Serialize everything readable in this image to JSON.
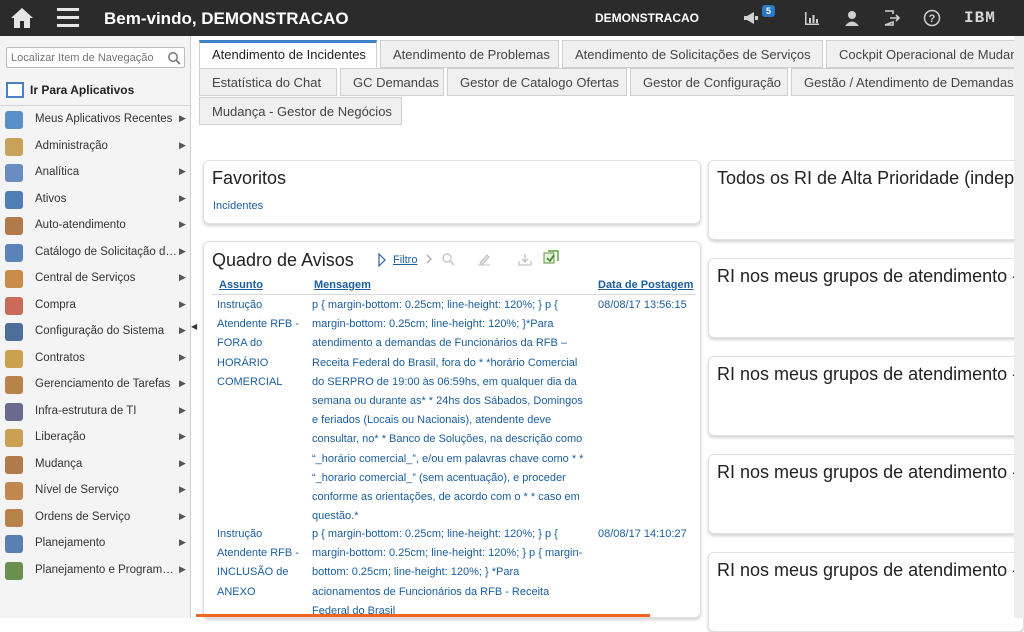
{
  "topbar": {
    "title": "Bem-vindo, DEMONSTRACAO",
    "user": "DEMONSTRACAO",
    "notification_count": "5",
    "brand": "IBM"
  },
  "sidebar": {
    "search_placeholder": "Localizar Item de Navegação",
    "goto_label": "Ir Para Aplicativos",
    "items": [
      {
        "label": "Meus Aplicativos Recentes",
        "icon": "recent-apps-icon",
        "color": "#5b8fc7"
      },
      {
        "label": "Administração",
        "icon": "administration-icon",
        "color": "#c9a25a"
      },
      {
        "label": "Analítica",
        "icon": "analytics-icon",
        "color": "#6a8cc0"
      },
      {
        "label": "Ativos",
        "icon": "assets-icon",
        "color": "#4f7fb5"
      },
      {
        "label": "Auto-atendimento",
        "icon": "self-service-icon",
        "color": "#b07a4a"
      },
      {
        "label": "Catálogo de Solicitação de Serviço",
        "icon": "service-catalog-icon",
        "color": "#5a84b8"
      },
      {
        "label": "Central de Serviços",
        "icon": "service-desk-icon",
        "color": "#c88b4a"
      },
      {
        "label": "Compra",
        "icon": "purchase-icon",
        "color": "#c96a5a"
      },
      {
        "label": "Configuração do Sistema",
        "icon": "system-config-icon",
        "color": "#4b6f99"
      },
      {
        "label": "Contratos",
        "icon": "contracts-icon",
        "color": "#c8a24e"
      },
      {
        "label": "Gerenciamento de Tarefas",
        "icon": "task-management-icon",
        "color": "#b8834a"
      },
      {
        "label": "Infra-estrutura de TI",
        "icon": "it-infrastructure-icon",
        "color": "#6a6a8c"
      },
      {
        "label": "Liberação",
        "icon": "release-icon",
        "color": "#caa052"
      },
      {
        "label": "Mudança",
        "icon": "change-icon",
        "color": "#b07a4a"
      },
      {
        "label": "Nível de Serviço",
        "icon": "service-level-icon",
        "color": "#c08850"
      },
      {
        "label": "Ordens de Serviço",
        "icon": "work-orders-icon",
        "color": "#b8834a"
      },
      {
        "label": "Planejamento",
        "icon": "planning-icon",
        "color": "#5a7fb0"
      },
      {
        "label": "Planejamento e Programação",
        "icon": "planning-scheduling-icon",
        "color": "#6b8f4f"
      }
    ]
  },
  "tabs": [
    {
      "label": "Atendimento de Incidentes",
      "active": true
    },
    {
      "label": "Atendimento de Problemas"
    },
    {
      "label": "Atendimento de Solicitações de Serviços"
    },
    {
      "label": "Cockpit Operacional de Mudança"
    },
    {
      "label": "Estatística do Chat"
    },
    {
      "label": "GC Demandas"
    },
    {
      "label": "Gestor de Catalogo Ofertas"
    },
    {
      "label": "Gestor de Configuração"
    },
    {
      "label": "Gestão / Atendimento de Demandas"
    },
    {
      "label": "Mudança - Gestor de Negócios"
    }
  ],
  "favorites": {
    "title": "Favoritos",
    "link": "Incidentes"
  },
  "bulletin": {
    "title": "Quadro de Avisos",
    "filter_label": "Filtro",
    "columns": {
      "subject": "Assunto",
      "message": "Mensagem",
      "date": "Data de Postagem"
    },
    "rows": [
      {
        "subject": "Instrução Atendente RFB - FORA do HORÁRIO COMERCIAL",
        "message": "p { margin-bottom: 0.25cm; line-height: 120%; } p { margin-bottom: 0.25cm; line-height: 120%; }*Para atendimento a demandas de Funcionários da RFB – Receita Federal do Brasil, fora do * *horário Comercial do SERPRO de 19:00 às 06:59hs, em qualquer dia da semana ou durante as* * 24hs dos Sábados, Domingos e feriados (Locais ou Nacionais), atendente deve consultar, no* * Banco de Soluções, na descrição como “_horário comercial_”, e/ou em palavras chave como * * “_horario comercial_” (sem acentuação), e proceder conforme as orientações, de acordo com o * * caso em questão.*",
        "date": "08/08/17 13:56:15"
      },
      {
        "subject": "Instrução Atendente RFB - INCLUSÃO de ANEXO",
        "message": "p { margin-bottom: 0.25cm; line-height: 120%; } p { margin-bottom: 0.25cm; line-height: 120%; } p { margin-bottom: 0.25cm; line-height: 120%; } *Para acionamentos de Funcionários da RFB - Receita Federal do Brasil",
        "date": "08/08/17 14:10:27"
      }
    ]
  },
  "right_cards": [
    {
      "title": "Todos os RI de Alta Prioridade (independente de grupo)"
    },
    {
      "title": "RI nos meus grupos de atendimento - Aguardando"
    },
    {
      "title": "RI nos meus grupos de atendimento - Em Atendimento"
    },
    {
      "title": "RI nos meus grupos de atendimento - Pendente"
    },
    {
      "title": "RI nos meus grupos de atendimento - Resolvido"
    }
  ]
}
